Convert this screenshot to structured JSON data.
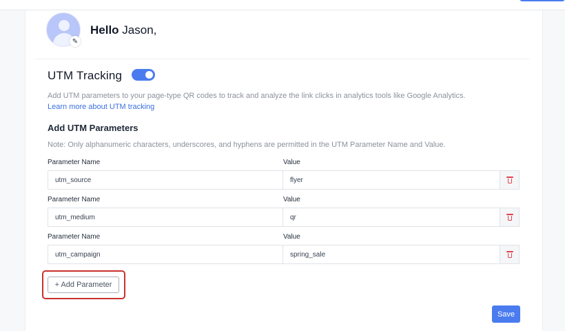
{
  "header": {
    "greeting_prefix": "Hello",
    "user_name": "Jason,"
  },
  "utm": {
    "title": "UTM Tracking",
    "enabled": true,
    "description": "Add UTM parameters to your page-type QR codes to track and analyze the link clicks in analytics tools like Google Analytics.",
    "learn_more": "Learn more about UTM tracking"
  },
  "params_section": {
    "title": "Add UTM Parameters",
    "note": "Note: Only alphanumeric characters, underscores, and hyphens are permitted in the UTM Parameter Name and Value.",
    "name_label": "Parameter Name",
    "value_label": "Value",
    "rows": [
      {
        "name": "utm_source",
        "value": "flyer"
      },
      {
        "name": "utm_medium",
        "value": "qr"
      },
      {
        "name": "utm_campaign",
        "value": "spring_sale"
      }
    ],
    "add_label": "+ Add Parameter"
  },
  "actions": {
    "save_label": "Save"
  },
  "colors": {
    "accent": "#4a7cf0",
    "delete": "#e0414b",
    "highlight": "#c9302c"
  },
  "icons": {
    "avatar": "user-avatar-icon",
    "edit": "pencil-icon",
    "delete": "trash-icon"
  }
}
